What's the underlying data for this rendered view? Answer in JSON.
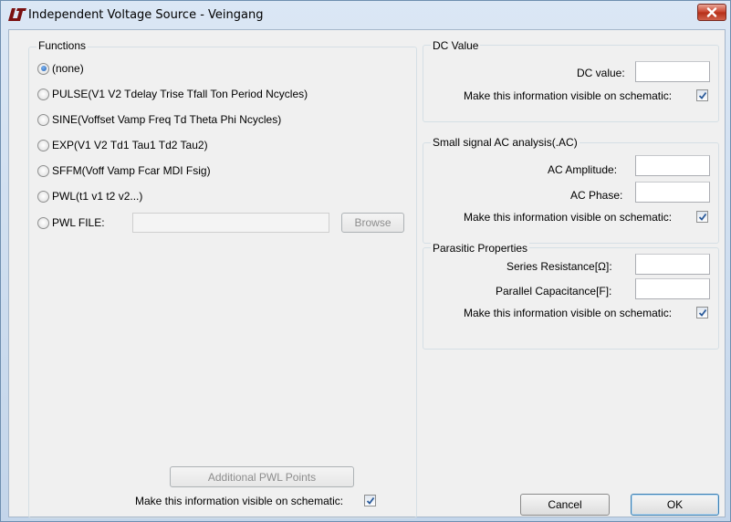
{
  "window": {
    "title": "Independent Voltage Source - Veingang",
    "app_icon": "ltspice-logo-icon",
    "close_icon": "close-icon"
  },
  "functions": {
    "title": "Functions",
    "options": [
      {
        "label": "(none)",
        "checked": true
      },
      {
        "label": "PULSE(V1 V2 Tdelay Trise Tfall Ton Period Ncycles)",
        "checked": false
      },
      {
        "label": "SINE(Voffset Vamp Freq Td Theta Phi Ncycles)",
        "checked": false
      },
      {
        "label": "EXP(V1 V2 Td1 Tau1 Td2 Tau2)",
        "checked": false
      },
      {
        "label": "SFFM(Voff Vamp Fcar MDI Fsig)",
        "checked": false
      },
      {
        "label": "PWL(t1 v1 t2 v2...)",
        "checked": false
      },
      {
        "label": "PWL FILE:",
        "checked": false
      }
    ],
    "pwl_file_value": "",
    "browse_label": "Browse",
    "additional_pwl_label": "Additional PWL Points",
    "visible_label": "Make this information visible on schematic:",
    "visible_checked": true
  },
  "dc": {
    "title": "DC Value",
    "value_label": "DC value:",
    "value": "",
    "visible_label": "Make this information visible on schematic:",
    "visible_checked": true
  },
  "ac": {
    "title": "Small signal AC analysis(.AC)",
    "amplitude_label": "AC Amplitude:",
    "amplitude_value": "",
    "phase_label": "AC Phase:",
    "phase_value": "",
    "visible_label": "Make this information visible on schematic:",
    "visible_checked": true
  },
  "parasitic": {
    "title": "Parasitic Properties",
    "series_label": "Series Resistance[Ω]:",
    "series_value": "",
    "parallel_label": "Parallel Capacitance[F]:",
    "parallel_value": "",
    "visible_label": "Make this information visible on schematic:",
    "visible_checked": true
  },
  "buttons": {
    "cancel": "Cancel",
    "ok": "OK"
  }
}
